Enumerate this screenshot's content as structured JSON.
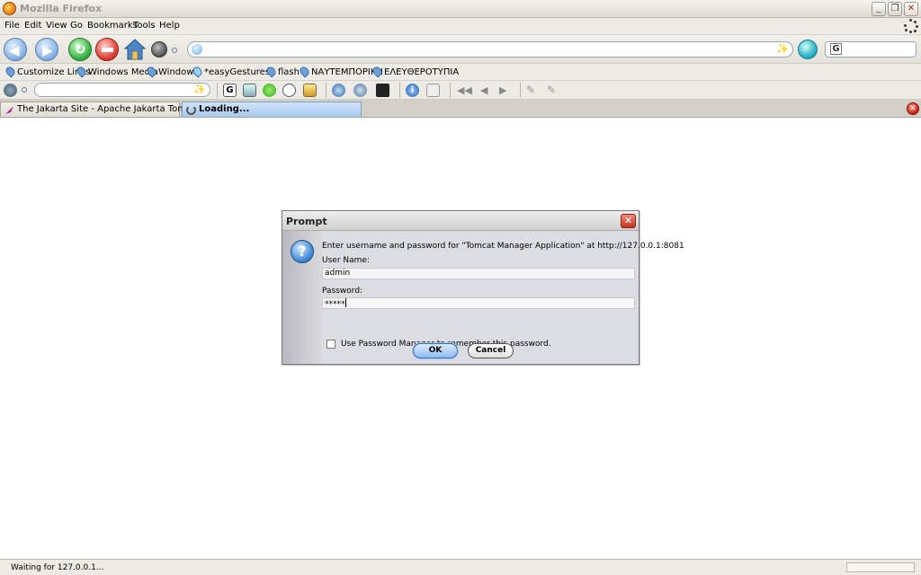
{
  "window": {
    "title": "Mozilla Firefox",
    "buttons": {
      "minimize": "_",
      "restore": "❐",
      "close": "✕"
    }
  },
  "menu": [
    "File",
    "Edit",
    "View",
    "Go",
    "Bookmarks",
    "Tools",
    "Help"
  ],
  "navigation": {
    "url_value": "",
    "search_value": "",
    "search_engine_glyph": "G"
  },
  "bookmarks": [
    "Customize Links",
    "Windows Media",
    "Windows",
    "*easyGestures*",
    "flash",
    "ΝΑΥΤΕΜΠΟΡΙΚΗ",
    "ΕΛΕΥΘΕΡΟΤΥΠΙΑ"
  ],
  "extra_toolbar": {
    "input_value": "",
    "icons": [
      "translate-icon",
      "google-icon",
      "highlight-icon",
      "clover-icon",
      "speech-bubble-icon",
      "dictionary-icon",
      "search-users-icon",
      "search-links-icon",
      "graduation-icon",
      "info-icon",
      "export-icon",
      "rewind-icon",
      "previous-icon",
      "next-icon",
      "pen-icon",
      "eraser-icon"
    ]
  },
  "tabs": [
    {
      "label": "The Jakarta Site - Apache Jakarta Tomcat",
      "active": false
    },
    {
      "label": "Loading...",
      "active": true
    }
  ],
  "dialog": {
    "title": "Prompt",
    "message": "Enter username and password for \"Tomcat Manager Application\" at http://127.0.0.1:8081",
    "username_label": "User Name:",
    "username_value": "admin",
    "password_label": "Password:",
    "password_value": "*****",
    "remember_label": "Use Password Manager to remember this password.",
    "remember_checked": false,
    "ok_label": "OK",
    "cancel_label": "Cancel",
    "close_glyph": "✕",
    "icon_glyph": "?"
  },
  "status": {
    "text": "Waiting for 127.0.0.1..."
  },
  "colors": {
    "dialog_bg": "#dcdde2",
    "tab_active": "#a8c9ef",
    "ok_button": "#8fbbef"
  }
}
